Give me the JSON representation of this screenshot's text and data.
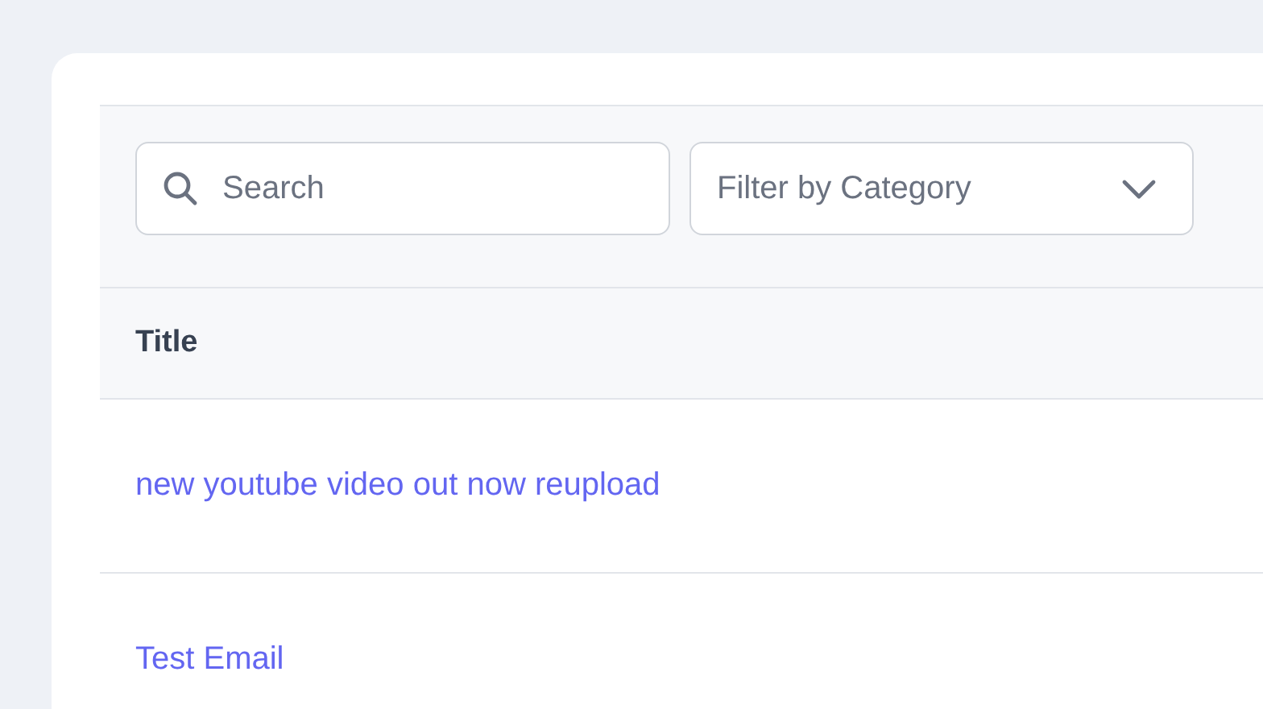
{
  "search": {
    "placeholder": "Search"
  },
  "filter": {
    "placeholder": "Filter by Category"
  },
  "table": {
    "columns": [
      "Title"
    ],
    "rows": [
      {
        "title": "new youtube video out now reupload"
      },
      {
        "title": "Test Email"
      }
    ]
  }
}
